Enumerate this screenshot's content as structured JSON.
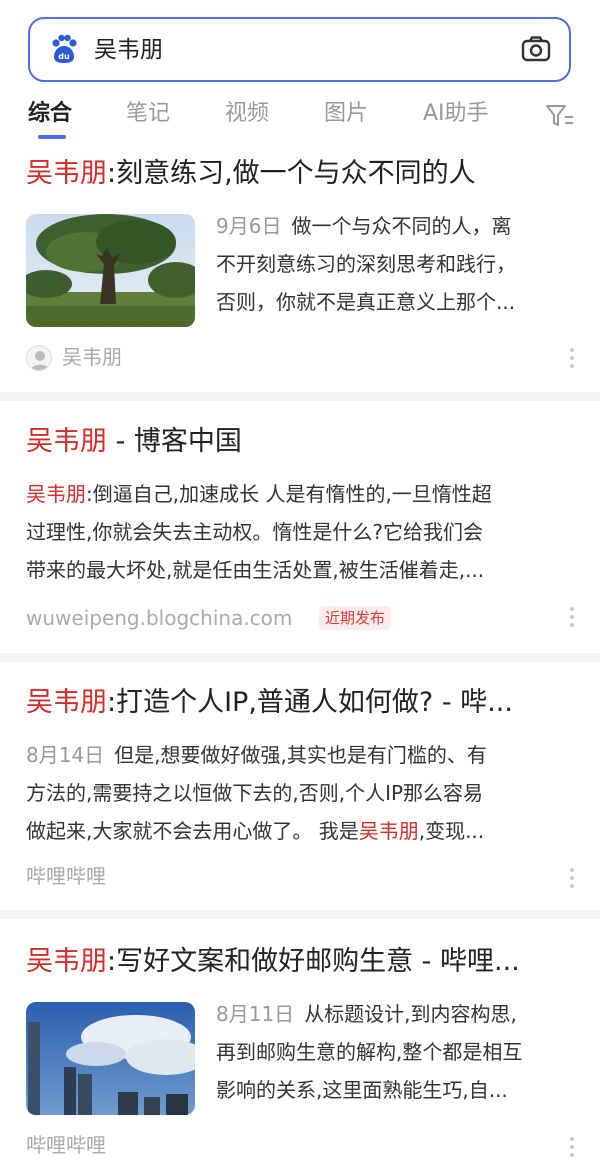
{
  "search": {
    "query": "吴韦朋",
    "logo_icon": "baidu-paw-logo",
    "camera_icon": "camera-icon",
    "accent": "#4e6ef2"
  },
  "tabs": [
    {
      "label": "综合",
      "active": true
    },
    {
      "label": "笔记",
      "active": false
    },
    {
      "label": "视频",
      "active": false
    },
    {
      "label": "图片",
      "active": false
    },
    {
      "label": "AI助手",
      "active": false
    }
  ],
  "filter_icon": "filter-icon",
  "highlight_color": "#d82c28",
  "results": [
    {
      "title_hl": "吴韦朋",
      "title_rest": ":刻意练习,做一个与众不同的人",
      "date": "9月6日",
      "snippet_lines": [
        "做一个与众不同的人，离",
        "不开刻意练习的深刻思考和践行，",
        "否则，你就不是真正意义上那个..."
      ],
      "source": "吴韦朋"
    },
    {
      "title_hl": "吴韦朋",
      "title_rest": " - 博客中国",
      "snippet_hl": "吴韦朋",
      "snippet_lines": [
        ":倒逼自己,加速成长 人是有惰性的,一旦惰性超",
        "过理性,你就会失去主动权。惰性是什么?它给我们会",
        "带来的最大坏处,就是任由生活处置,被生活催着走,..."
      ],
      "source": "wuweipeng.blogchina.com",
      "badge": "近期发布"
    },
    {
      "title_hl": "吴韦朋",
      "title_rest": ":打造个人IP,普通人如何做? - 哔...",
      "date": "8月14日",
      "snippet_lines": [
        "但是,想要做好做强,其实也是有门槛的、有",
        "方法的,需要持之以恒做下去的,否则,个人IP那么容易",
        "做起来,大家就不会去用心做了。 我是"
      ],
      "snippet_tail_hl": "吴韦朋",
      "snippet_tail": ",变现...",
      "source": "哔哩哔哩"
    },
    {
      "title_hl": "吴韦朋",
      "title_rest": ":写好文案和做好邮购生意 - 哔哩...",
      "date": "8月11日",
      "snippet_lines": [
        "从标题设计,到内容构思,",
        "再到邮购生意的解构,整个都是相互",
        "影响的关系,这里面熟能生巧,自..."
      ],
      "source": "哔哩哔哩"
    }
  ]
}
